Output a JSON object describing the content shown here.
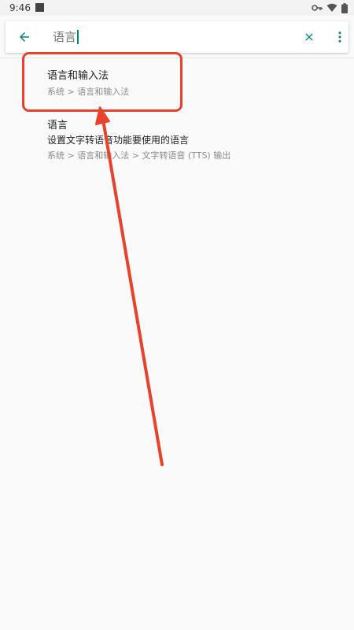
{
  "status_bar": {
    "time": "9:46",
    "icons": [
      "vpn-key-icon",
      "wifi-icon",
      "battery-icon"
    ]
  },
  "search": {
    "query": "语言",
    "back_icon": "arrow-back-icon",
    "clear_icon": "close-icon",
    "more_icon": "more-vert-icon",
    "accent_color": "#00897b"
  },
  "results": [
    {
      "title": "语言和输入法",
      "breadcrumb": "系统 > 语言和输入法"
    },
    {
      "title": "语言",
      "summary": "设置文字转语音功能要使用的语言",
      "breadcrumb": "系统 > 语言和输入法 > 文字转语音 (TTS) 输出"
    }
  ],
  "annotation": {
    "color": "#e8412c",
    "shape": "highlight-box-with-arrow"
  }
}
